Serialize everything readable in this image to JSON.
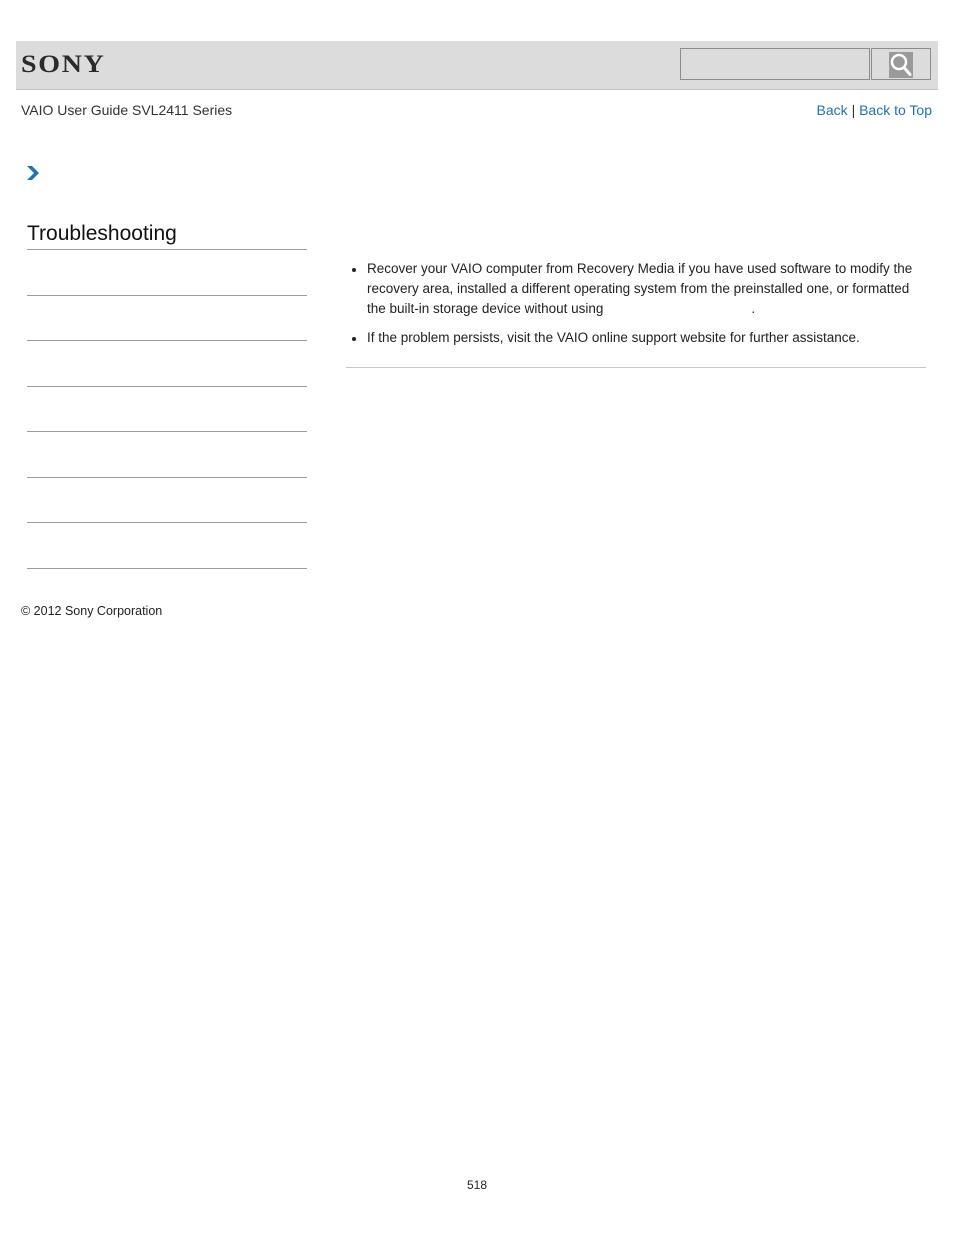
{
  "header": {
    "logo_text": "SONY",
    "search": {
      "placeholder": "",
      "value": ""
    },
    "search_button_icon": "search-icon"
  },
  "subheader": {
    "guide_title": "VAIO User Guide SVL2411 Series",
    "back_label": "Back",
    "separator": "|",
    "back_to_top_label": "Back to Top"
  },
  "breadcrumb": {
    "icon": "chevron-right-icon",
    "color": "#1f72b8"
  },
  "sidebar": {
    "title": "Troubleshooting",
    "items": [
      "",
      "",
      "",
      "",
      "",
      "",
      ""
    ]
  },
  "main": {
    "bullets": [
      {
        "text": "Recover your VAIO computer from Recovery Media if you have used software to modify the recovery area, installed a different operating system from the preinstalled one, or formatted the built-in storage device without using",
        "trailing": "."
      },
      {
        "text": "If the problem persists, visit the VAIO online support website for further assistance."
      }
    ]
  },
  "footer": {
    "copyright": "© 2012 Sony Corporation",
    "page_number": "518"
  },
  "colors": {
    "link": "#1f72b8",
    "header_bg": "#dcdcdc"
  }
}
